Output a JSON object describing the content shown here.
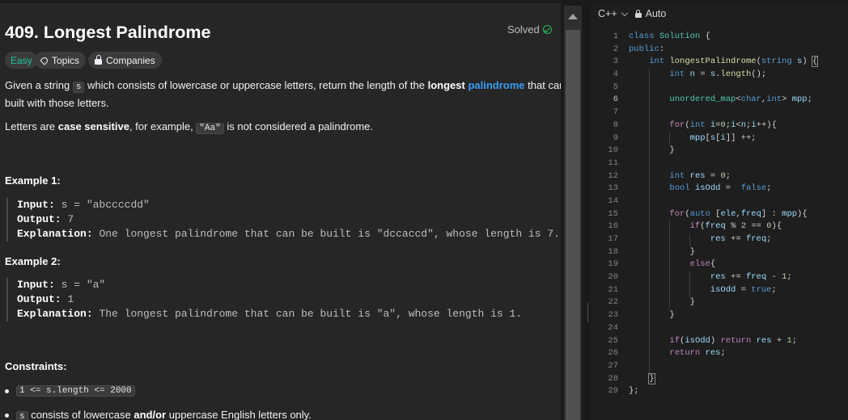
{
  "problem": {
    "title": "409. Longest Palindrome",
    "status": "Solved",
    "tags": {
      "difficulty": "Easy",
      "topics": "Topics",
      "companies": "Companies"
    },
    "desc1": {
      "a": "Given a string ",
      "code": "s",
      "b": " which consists of lowercase or uppercase letters, return the length of the ",
      "bold": "longest",
      "link": "palindrome",
      "c": " that can be",
      "line2": "built with those letters."
    },
    "desc2": {
      "a": "Letters are ",
      "bold": "case sensitive",
      "b": ", for example, ",
      "code": "\"Aa\"",
      "c": " is not considered a palindrome."
    },
    "examples": [
      {
        "heading": "Example 1:",
        "input_label": "Input:",
        "input": "s = \"abccccdd\"",
        "output_label": "Output:",
        "output": "7",
        "expl_label": "Explanation:",
        "explanation": "One longest palindrome that can be built is \"dccaccd\", whose length is 7."
      },
      {
        "heading": "Example 2:",
        "input_label": "Input:",
        "input": "s = \"a\"",
        "output_label": "Output:",
        "output": "1",
        "expl_label": "Explanation:",
        "explanation": "The longest palindrome that can be built is \"a\", whose length is 1."
      }
    ],
    "constraints": {
      "heading": "Constraints:",
      "item1_code": "1 <= s.length <= 2000",
      "item2_code": "s",
      "item2_a": " consists of lowercase ",
      "item2_bold": "and/or",
      "item2_b": " uppercase English letters only."
    }
  },
  "editor": {
    "language": "C++",
    "mode": "Auto",
    "line_numbers": [
      "1",
      "2",
      "3",
      "4",
      "5",
      "6",
      "7",
      "8",
      "9",
      "10",
      "11",
      "12",
      "13",
      "14",
      "15",
      "16",
      "17",
      "18",
      "19",
      "20",
      "21",
      "22",
      "23",
      "24",
      "25",
      "26",
      "27",
      "28",
      "29"
    ]
  },
  "colors": {
    "accent_link": "#3b9cf5",
    "easy": "#25c4a3",
    "solved_check": "#2cbb5d",
    "panel_bg": "#262626",
    "editor_bg": "#1e1e1e"
  }
}
